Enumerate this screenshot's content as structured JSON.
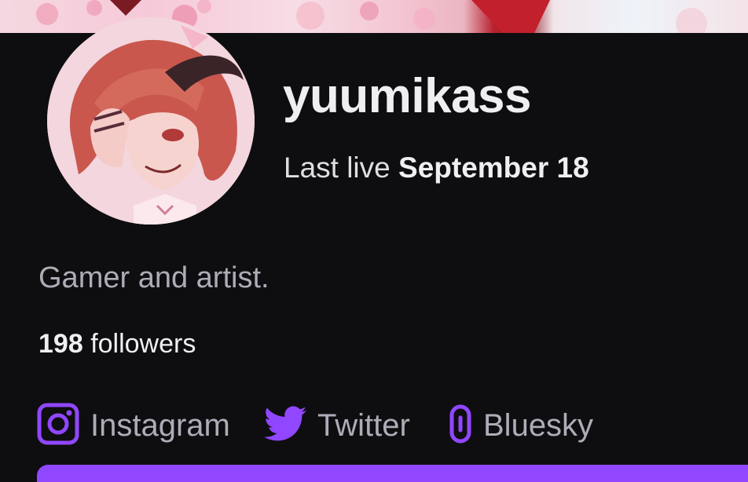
{
  "channel": {
    "username": "yuumikass",
    "last_live_prefix": "Last live",
    "last_live_date": "September 18",
    "bio": "Gamer and artist.",
    "followers_count": "198",
    "followers_label": "followers"
  },
  "social_links": [
    {
      "label": "Instagram",
      "icon": "instagram-icon"
    },
    {
      "label": "Twitter",
      "icon": "twitter-bird-icon"
    },
    {
      "label": "Bluesky",
      "icon": "link-icon"
    }
  ],
  "colors": {
    "background": "#0e0e10",
    "accent": "#9147ff",
    "text_primary": "#efeff1",
    "text_secondary": "#adadb8"
  }
}
